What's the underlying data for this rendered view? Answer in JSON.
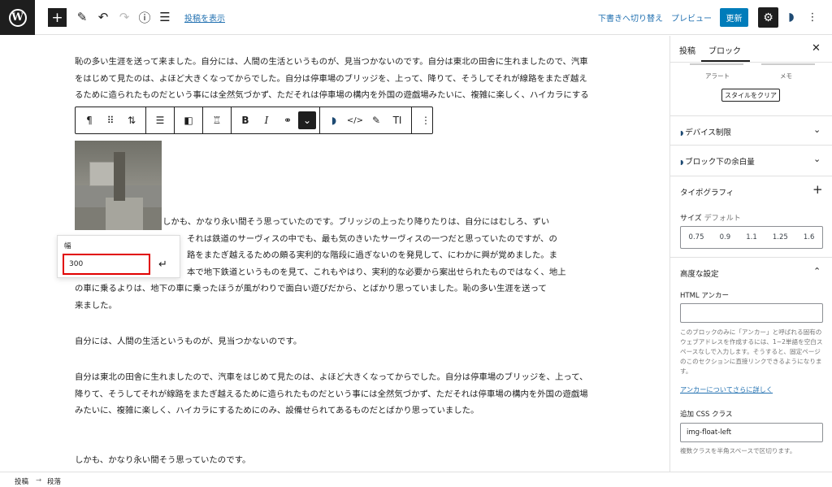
{
  "topbar": {
    "logo_letter": "W",
    "add_icon": "+",
    "tool_icon": "✎",
    "undo_icon": "↶",
    "redo_icon": "↷",
    "info_icon": "ⓘ",
    "list_icon": "☰",
    "view_post": "投稿を表示",
    "save_draft": "下書きへ切り替え",
    "preview": "プレビュー",
    "update": "更新",
    "settings_icon": "⚙",
    "plugin_icon": "◗",
    "more_icon": "⋮"
  },
  "content": {
    "paragraph1": "恥の多い生涯を送って来ました。自分には、人間の生活というものが、見当つかないのです。自分は東北の田舎に生れましたので、汽車をはじめて見たのは、よほど大きくなってからでした。自分は停車場のブリッジを、上って、降りて、そうしてそれが線路をまたぎ越えるために造られたものだという事には全然気づかず、ただそれは停車場の構内を外国の遊戯場みたいに、複雑に楽しく、ハイカラにするためにのみ、設備せられてあるものだとばかり思っていました。",
    "float_lines": [
      "しかも、かなり永い間そう思っていたのです。ブリッジの上ったり降りたりは、自分にはむしろ、ずい",
      "それは鉄道のサーヴィスの中でも、最も気のきいたサーヴィスの一つだと思っていたのですが、の",
      "路をまたぎ越えるための頗る実利的な階段に過ぎないのを発見して、にわかに興が覚めました。ま",
      "本で地下鉄道というものを見て、これもやはり、実利的な必要から案出せられたものではなく、地上",
      "の車に乗るよりは、地下の車に乗ったほうが風がわりで面白い遊びだから、とばかり思っていました。恥の多い生涯を送って",
      "来ました。"
    ],
    "paragraph3": "自分には、人間の生活というものが、見当つかないのです。",
    "paragraph4": "自分は東北の田舎に生れましたので、汽車をはじめて見たのは、よほど大きくなってからでした。自分は停車場のブリッジを、上って、降りて、そうしてそれが線路をまたぎ越えるために造られたものだという事には全然気づかず、ただそれは停車場の構内を外国の遊戯場みたいに、複雑に楽しく、ハイカラにするためにのみ、設備せられてあるものだとばかり思っていました。",
    "paragraph5": "しかも、かなり永い間そう思っていたのです。"
  },
  "block_toolbar": {
    "paragraph_icon": "¶",
    "drag_icon": "⠿",
    "move_icon": "⇅",
    "align_icon": "☰",
    "float_icon": "◧",
    "style_icon": "♖",
    "bold": "B",
    "italic": "I",
    "link_icon": "⚭",
    "dropdown_icon": "⌄",
    "plugin_icon": "◗",
    "code_icon": "</>",
    "highlight_icon": "✎",
    "text_icon": "TI",
    "more_icon": "⋮"
  },
  "resize_popover": {
    "label": "幅",
    "value": "300",
    "apply_icon": "↵"
  },
  "sidebar": {
    "tab_post": "投稿",
    "tab_block": "ブロック",
    "close_icon": "✕",
    "style_name_1": "アラート",
    "style_name_2": "メモ",
    "clear_style": "スタイルをクリア",
    "panel_device": "デバイス制限",
    "panel_margin": "ブロック下の余白量",
    "panel_typography": "タイポグラフィ",
    "size_label": "サイズ",
    "size_default": "デフォルト",
    "size_options": [
      "0.75",
      "0.9",
      "1.1",
      "1.25",
      "1.6"
    ],
    "advanced": "高度な設定",
    "anchor_label": "HTML アンカー",
    "anchor_value": "",
    "anchor_help": "このブロックのみに「アンカー」と呼ばれる固有のウェブアドレスを作成するには、1~2単語を空白スペースなしで入力します。そうすると、固定ページのこのセクションに直接リンクできるようになります。",
    "anchor_link": "アンカーについてさらに詳しく",
    "css_label": "追加 CSS クラス",
    "css_value": "img-float-left",
    "css_help": "複数クラスを半角スペースで区切ります。",
    "chevron_icon": "⌄",
    "chevron_up_icon": "⌃",
    "plus_icon": "+",
    "leaf_icon": "◗"
  },
  "footer": {
    "crumb1": "投稿",
    "separator": "→",
    "crumb2": "段落"
  },
  "colors": {
    "accent": "#007cba",
    "link": "#2271b1",
    "highlight_border": "#e10000"
  }
}
